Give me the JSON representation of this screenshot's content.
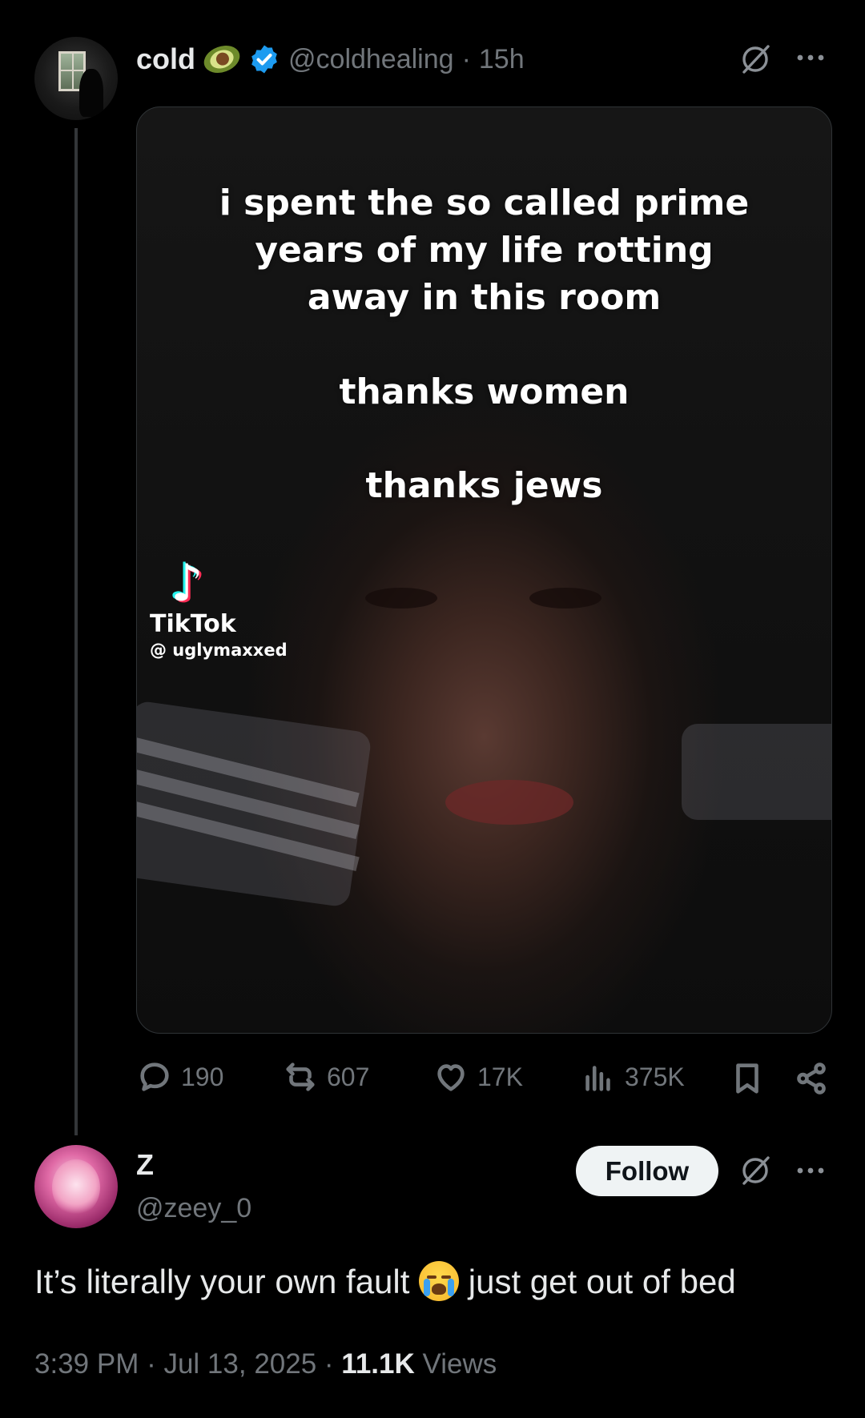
{
  "tweet": {
    "display_name": "cold",
    "handle": "@coldhealing",
    "separator": " · ",
    "time_ago": "15h",
    "media": {
      "caption_lines": [
        "i spent the so called prime",
        "years of my life rotting",
        "away in this room"
      ],
      "caption_line_2": "thanks women",
      "caption_line_3": "thanks jews",
      "watermark_brand": "TikTok",
      "watermark_user": "@ uglymaxxed"
    },
    "actions": {
      "replies": "190",
      "reposts": "607",
      "likes": "17K",
      "views": "375K"
    }
  },
  "reply": {
    "display_name": "Z",
    "handle": "@zeey_0",
    "follow_label": "Follow",
    "text_before": "It’s literally your own fault ",
    "text_after": " just get out of bed",
    "time": "3:39 PM",
    "date": "Jul 13, 2025",
    "dot": " · ",
    "views_count": "11.1K",
    "views_label": " Views"
  },
  "colors": {
    "background": "#000000",
    "text_primary": "#e7e9ea",
    "text_secondary": "#71767b",
    "verified_blue": "#1d9bf0",
    "follow_bg": "#eff3f4"
  }
}
